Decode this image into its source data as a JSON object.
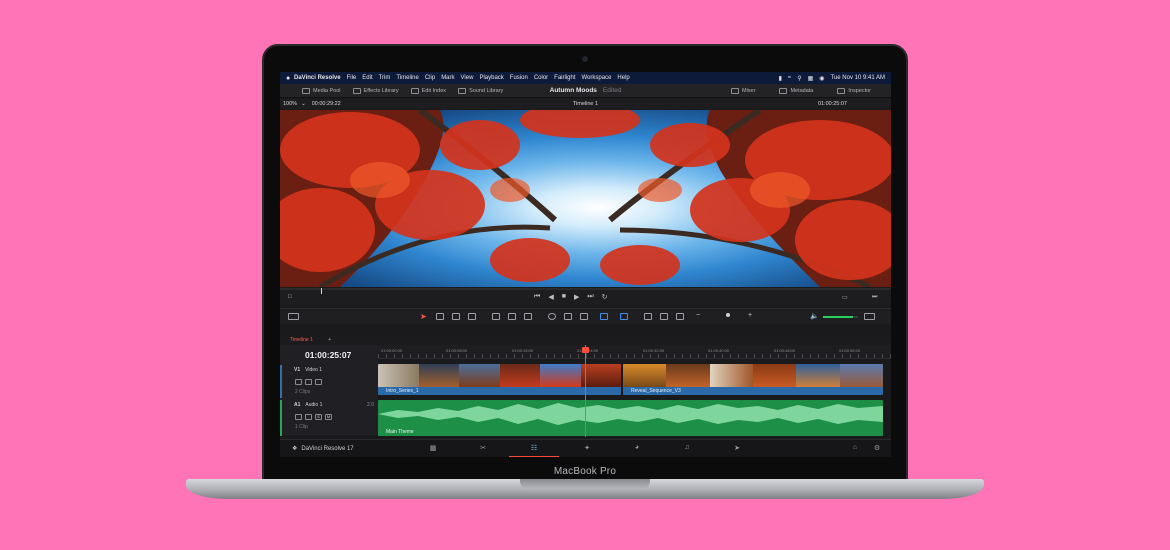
{
  "device": {
    "label": "MacBook Pro"
  },
  "menubar": {
    "app": "DaVinci Resolve",
    "items": [
      "File",
      "Edit",
      "Trim",
      "Timeline",
      "Clip",
      "Mark",
      "View",
      "Playback",
      "Fusion",
      "Color",
      "Fairlight",
      "Workspace",
      "Help"
    ],
    "datetime": "Tue Nov 10  9:41 AM"
  },
  "toolbar": {
    "media_pool": "Media Pool",
    "effects_library": "Effects Library",
    "edit_index": "Edit Index",
    "sound_library": "Sound Library",
    "project_name": "Autumn Moods",
    "status": "Edited",
    "mixer": "Mixer",
    "metadata": "Metadata",
    "inspector": "Inspector"
  },
  "viewer": {
    "zoom": "100%",
    "source_timecode": "00:00:29:22",
    "timeline_name": "Timeline 1",
    "record_timecode": "01:00:25:07"
  },
  "timeline": {
    "tab": "Timeline 1",
    "timecode": "01:00:25:07",
    "ruler": [
      "01:00:00:00",
      "01:00:08:00",
      "01:00:16:00",
      "01:00:24:00",
      "01:00:32:00",
      "01:00:40:00",
      "01:00:48:00",
      "01:00:56:00"
    ],
    "tracks": {
      "video": {
        "id": "V1",
        "name": "Video 1",
        "clips_count": "2 Clips"
      },
      "audio": {
        "id": "A1",
        "name": "Audio 1",
        "level": "2.0",
        "clips_count": "1 Clip"
      }
    },
    "clips": {
      "video1": "Intro_Series_1",
      "video2": "Reveal_Sequence_V3",
      "audio1": "Main Theme"
    }
  },
  "pagebar": {
    "app_version": "DaVinci Resolve 17"
  },
  "colors": {
    "background": "#ff73b7",
    "accent": "#ff4d3d",
    "video_clip": "#2b6aa8",
    "audio_clip": "#1d8f47"
  }
}
